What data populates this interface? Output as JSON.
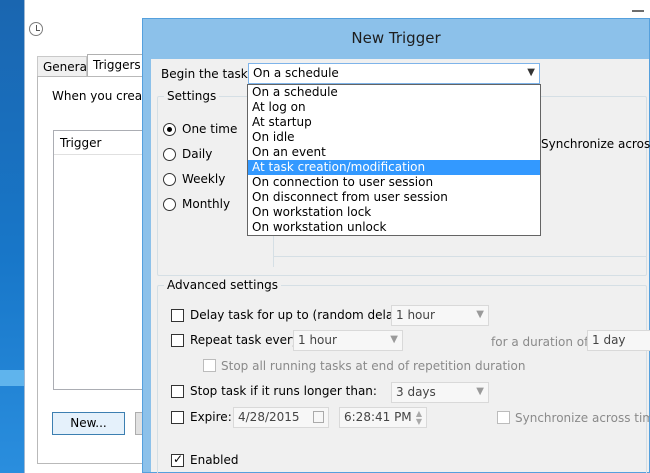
{
  "background_window": {
    "tabs": [
      "General",
      "Triggers"
    ],
    "intro_text": "When you create",
    "list_header": "Trigger",
    "new_button": "New..."
  },
  "dialog": {
    "title": "New Trigger",
    "begin_label": "Begin the task:",
    "begin_value": "On a schedule",
    "dropdown_options": [
      "On a schedule",
      "At log on",
      "At startup",
      "On idle",
      "On an event",
      "At task creation/modification",
      "On connection to user session",
      "On disconnect from user session",
      "On workstation lock",
      "On workstation unlock"
    ],
    "highlighted_option_index": 5,
    "settings": {
      "title": "Settings",
      "radios": [
        "One time",
        "Daily",
        "Weekly",
        "Monthly"
      ],
      "selected_radio": "One time",
      "sync_label": "Synchronize across t"
    },
    "advanced": {
      "title": "Advanced settings",
      "delay_label": "Delay task for up to (random delay):",
      "delay_value": "1 hour",
      "repeat_label": "Repeat task every:",
      "repeat_value": "1 hour",
      "duration_label": "for a duration of:",
      "duration_value": "1 day",
      "stop_all_label": "Stop all running tasks at end of repetition duration",
      "stop_label": "Stop task if it runs longer than:",
      "stop_value": "3 days",
      "expire_label": "Expire:",
      "expire_date": "4/28/2015",
      "expire_time": "6:28:41 PM",
      "expire_sync_label": "Synchronize across time z",
      "enabled_label": "Enabled"
    }
  },
  "colors": {
    "dialog_title_bg": "#8cc1ea",
    "selection": "#3399ff",
    "desktop": "#1d6fb8"
  }
}
